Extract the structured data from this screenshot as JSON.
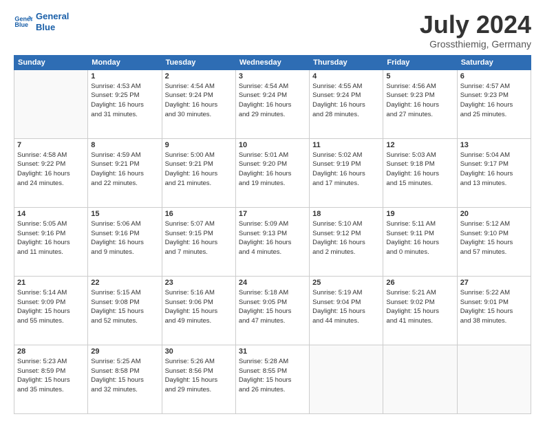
{
  "header": {
    "logo_line1": "General",
    "logo_line2": "Blue",
    "title": "July 2024",
    "subtitle": "Grossthiemig, Germany"
  },
  "calendar": {
    "days_of_week": [
      "Sunday",
      "Monday",
      "Tuesday",
      "Wednesday",
      "Thursday",
      "Friday",
      "Saturday"
    ],
    "weeks": [
      [
        {
          "day": "",
          "info": ""
        },
        {
          "day": "1",
          "info": "Sunrise: 4:53 AM\nSunset: 9:25 PM\nDaylight: 16 hours\nand 31 minutes."
        },
        {
          "day": "2",
          "info": "Sunrise: 4:54 AM\nSunset: 9:24 PM\nDaylight: 16 hours\nand 30 minutes."
        },
        {
          "day": "3",
          "info": "Sunrise: 4:54 AM\nSunset: 9:24 PM\nDaylight: 16 hours\nand 29 minutes."
        },
        {
          "day": "4",
          "info": "Sunrise: 4:55 AM\nSunset: 9:24 PM\nDaylight: 16 hours\nand 28 minutes."
        },
        {
          "day": "5",
          "info": "Sunrise: 4:56 AM\nSunset: 9:23 PM\nDaylight: 16 hours\nand 27 minutes."
        },
        {
          "day": "6",
          "info": "Sunrise: 4:57 AM\nSunset: 9:23 PM\nDaylight: 16 hours\nand 25 minutes."
        }
      ],
      [
        {
          "day": "7",
          "info": "Sunrise: 4:58 AM\nSunset: 9:22 PM\nDaylight: 16 hours\nand 24 minutes."
        },
        {
          "day": "8",
          "info": "Sunrise: 4:59 AM\nSunset: 9:21 PM\nDaylight: 16 hours\nand 22 minutes."
        },
        {
          "day": "9",
          "info": "Sunrise: 5:00 AM\nSunset: 9:21 PM\nDaylight: 16 hours\nand 21 minutes."
        },
        {
          "day": "10",
          "info": "Sunrise: 5:01 AM\nSunset: 9:20 PM\nDaylight: 16 hours\nand 19 minutes."
        },
        {
          "day": "11",
          "info": "Sunrise: 5:02 AM\nSunset: 9:19 PM\nDaylight: 16 hours\nand 17 minutes."
        },
        {
          "day": "12",
          "info": "Sunrise: 5:03 AM\nSunset: 9:18 PM\nDaylight: 16 hours\nand 15 minutes."
        },
        {
          "day": "13",
          "info": "Sunrise: 5:04 AM\nSunset: 9:17 PM\nDaylight: 16 hours\nand 13 minutes."
        }
      ],
      [
        {
          "day": "14",
          "info": "Sunrise: 5:05 AM\nSunset: 9:16 PM\nDaylight: 16 hours\nand 11 minutes."
        },
        {
          "day": "15",
          "info": "Sunrise: 5:06 AM\nSunset: 9:16 PM\nDaylight: 16 hours\nand 9 minutes."
        },
        {
          "day": "16",
          "info": "Sunrise: 5:07 AM\nSunset: 9:15 PM\nDaylight: 16 hours\nand 7 minutes."
        },
        {
          "day": "17",
          "info": "Sunrise: 5:09 AM\nSunset: 9:13 PM\nDaylight: 16 hours\nand 4 minutes."
        },
        {
          "day": "18",
          "info": "Sunrise: 5:10 AM\nSunset: 9:12 PM\nDaylight: 16 hours\nand 2 minutes."
        },
        {
          "day": "19",
          "info": "Sunrise: 5:11 AM\nSunset: 9:11 PM\nDaylight: 16 hours\nand 0 minutes."
        },
        {
          "day": "20",
          "info": "Sunrise: 5:12 AM\nSunset: 9:10 PM\nDaylight: 15 hours\nand 57 minutes."
        }
      ],
      [
        {
          "day": "21",
          "info": "Sunrise: 5:14 AM\nSunset: 9:09 PM\nDaylight: 15 hours\nand 55 minutes."
        },
        {
          "day": "22",
          "info": "Sunrise: 5:15 AM\nSunset: 9:08 PM\nDaylight: 15 hours\nand 52 minutes."
        },
        {
          "day": "23",
          "info": "Sunrise: 5:16 AM\nSunset: 9:06 PM\nDaylight: 15 hours\nand 49 minutes."
        },
        {
          "day": "24",
          "info": "Sunrise: 5:18 AM\nSunset: 9:05 PM\nDaylight: 15 hours\nand 47 minutes."
        },
        {
          "day": "25",
          "info": "Sunrise: 5:19 AM\nSunset: 9:04 PM\nDaylight: 15 hours\nand 44 minutes."
        },
        {
          "day": "26",
          "info": "Sunrise: 5:21 AM\nSunset: 9:02 PM\nDaylight: 15 hours\nand 41 minutes."
        },
        {
          "day": "27",
          "info": "Sunrise: 5:22 AM\nSunset: 9:01 PM\nDaylight: 15 hours\nand 38 minutes."
        }
      ],
      [
        {
          "day": "28",
          "info": "Sunrise: 5:23 AM\nSunset: 8:59 PM\nDaylight: 15 hours\nand 35 minutes."
        },
        {
          "day": "29",
          "info": "Sunrise: 5:25 AM\nSunset: 8:58 PM\nDaylight: 15 hours\nand 32 minutes."
        },
        {
          "day": "30",
          "info": "Sunrise: 5:26 AM\nSunset: 8:56 PM\nDaylight: 15 hours\nand 29 minutes."
        },
        {
          "day": "31",
          "info": "Sunrise: 5:28 AM\nSunset: 8:55 PM\nDaylight: 15 hours\nand 26 minutes."
        },
        {
          "day": "",
          "info": ""
        },
        {
          "day": "",
          "info": ""
        },
        {
          "day": "",
          "info": ""
        }
      ]
    ]
  }
}
